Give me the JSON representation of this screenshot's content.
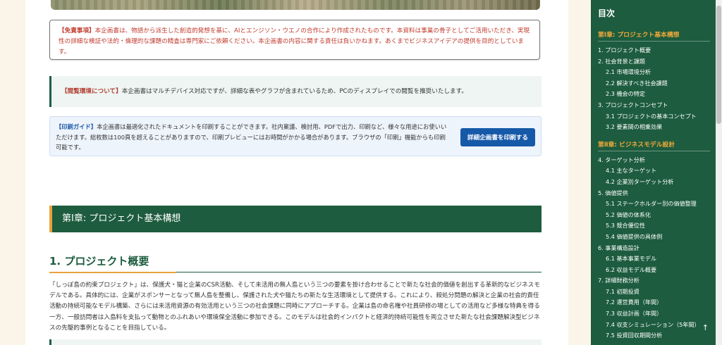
{
  "disclaimer": {
    "label": "【免責事項】",
    "text": "本企画書は、物語から派生した創造的発想を基に、AIとエンジソン・ウエノの合作により作成されたものです。本資料は事業の骨子としてご活用いただき、実現性の詳細な検証や法的・倫理的な課題の精査は専門家にご依頼ください。本企画書の内容に関する責任は負いかねます。あくまでビジネスアイデアの提供を目的としています。"
  },
  "environment": {
    "label": "【閲覧環境について】",
    "text": "本企画書はマルチデバイス対応ですが、詳細な表やグラフが含まれているため、PCのディスプレイでの閲覧を推奨いたします。"
  },
  "print_guide": {
    "label": "【印刷ガイド】",
    "text": "本企画書は最適化されたドキュメントを印刷することができます。社内稟議、検討用、PDFで出力、印刷など、様々な用途にお使いいただけます。総枚数は100頁を超えることがありますので、印刷プレビューにはお時間がかかる場合があります。ブラウザの「印刷」機能からも印刷可能です。",
    "button": "詳細企画書を印刷する"
  },
  "chapter": {
    "title": "第Ⅰ章: プロジェクト基本構想"
  },
  "section": {
    "title": "1. プロジェクト概要",
    "body": "「しっぽ島の約束プロジェクト」は、保護犬・猫と企業のCSR活動、そして未活用の無人島という三つの要素を掛け合わせることで新たな社会的価値を創出する革新的なビジネスモデルである。具体的には、企業がスポンサーとなって無人島を整備し、保護された犬や猫たちの新たな生活環境として提供する。これにより、殺処分問題の解決と企業の社会的責任活動の持続可能なモデル構築、さらには未活用資源の有効活用という三つの社会課題に同時にアプローチする。企業は島の命名権や社員研修の場としての活用など多様な特典を得る一方、一般訪問者は入島料を支払って動物とのふれあいや環境保全活動に参加できる。このモデルは社会的インパクトと経済的持続可能性を両立させた新たな社会課題解決型ビジネスの先駆的事例となることを目指している。"
  },
  "toc": {
    "title": "目次",
    "groups": [
      {
        "chapter": "第Ⅰ章: プロジェクト基本構想",
        "items": [
          {
            "label": "1. プロジェクト概要",
            "sub": false
          },
          {
            "label": "2. 社会背景と課題",
            "sub": false
          },
          {
            "label": "2.1 市場環境分析",
            "sub": true
          },
          {
            "label": "2.2 解決すべき社会課題",
            "sub": true
          },
          {
            "label": "2.3 機会の特定",
            "sub": true
          },
          {
            "label": "3. プロジェクトコンセプト",
            "sub": false
          },
          {
            "label": "3.1 プロジェクトの基本コンセプト",
            "sub": true
          },
          {
            "label": "3.2 要素間の相乗効果",
            "sub": true
          }
        ]
      },
      {
        "chapter": "第Ⅱ章: ビジネスモデル設計",
        "items": [
          {
            "label": "4. ターゲット分析",
            "sub": false
          },
          {
            "label": "4.1 主なターゲット",
            "sub": true
          },
          {
            "label": "4.2 企業別ターゲット分析",
            "sub": true
          },
          {
            "label": "5. 価値提供",
            "sub": false
          },
          {
            "label": "5.1 ステークホルダー別の価値整理",
            "sub": true
          },
          {
            "label": "5.2 価値の体系化",
            "sub": true
          },
          {
            "label": "5.3 競合優位性",
            "sub": true
          },
          {
            "label": "5.4 価値提供の具体例",
            "sub": true
          },
          {
            "label": "6. 事業構造設計",
            "sub": false
          },
          {
            "label": "6.1 基本事業モデル",
            "sub": true
          },
          {
            "label": "6.2 収益モデル概要",
            "sub": true
          },
          {
            "label": "7. 詳細財務分析",
            "sub": false
          },
          {
            "label": "7.1 初期投資",
            "sub": true
          },
          {
            "label": "7.2 運営費用（年間）",
            "sub": true
          },
          {
            "label": "7.3 収益計画（年間）",
            "sub": true
          },
          {
            "label": "7.4 収支シミュレーション（5年間）",
            "sub": true
          },
          {
            "label": "7.5 投資回収期間分析",
            "sub": true
          }
        ]
      }
    ],
    "back_to_top": "↑"
  }
}
